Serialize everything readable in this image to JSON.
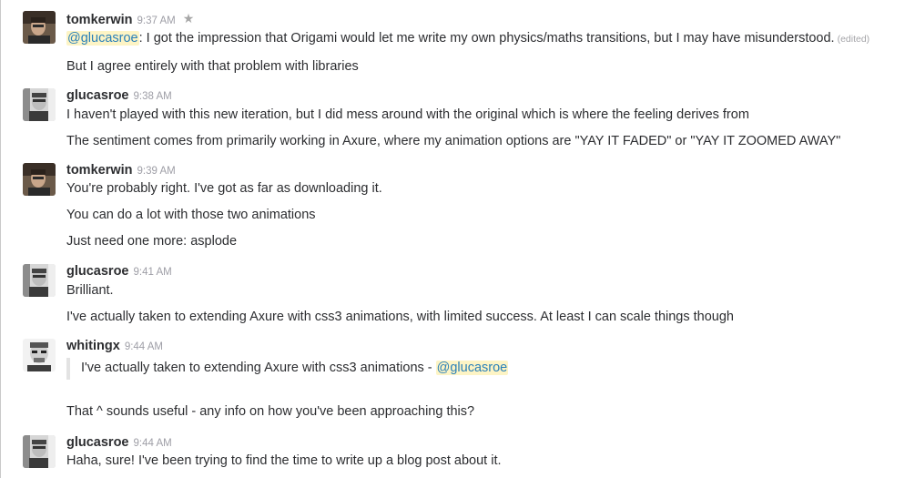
{
  "messages": [
    {
      "user": "tomkerwin",
      "time": "9:37 AM",
      "avatar": "avatar-tomkerwin",
      "starred": true,
      "lines": [
        {
          "mention": "@glucasroe",
          "text": ": I got the impression that Origami would let me write my own physics/maths transitions, but I may have misunderstood.",
          "edited": "(edited)"
        },
        {
          "text": "But I agree entirely with that problem with libraries"
        }
      ]
    },
    {
      "user": "glucasroe",
      "time": "9:38 AM",
      "avatar": "avatar-glucasroe",
      "lines": [
        {
          "text": "I haven't played with this new iteration, but I did mess around with the original which is where the feeling derives from"
        },
        {
          "text": "The sentiment comes from primarily working in Axure, where my animation options are \"YAY IT FADED\" or \"YAY IT ZOOMED AWAY\""
        }
      ]
    },
    {
      "user": "tomkerwin",
      "time": "9:39 AM",
      "avatar": "avatar-tomkerwin",
      "lines": [
        {
          "text": "You're probably right. I've got as far as downloading it."
        },
        {
          "text": "You can do a lot with those two animations"
        },
        {
          "text": "Just need one more: asplode"
        }
      ]
    },
    {
      "user": "glucasroe",
      "time": "9:41 AM",
      "avatar": "avatar-glucasroe",
      "lines": [
        {
          "text": "Brilliant."
        },
        {
          "text": "I've actually taken to extending Axure with css3 animations, with limited success. At least I can scale things though"
        }
      ]
    },
    {
      "user": "whitingx",
      "time": "9:44 AM",
      "avatar": "avatar-whitingx",
      "quote": {
        "text": "I've actually taken to extending Axure with css3 animations - ",
        "mention": "@glucasroe"
      },
      "lines": [
        {
          "text": "That ^ sounds useful - any info on how you've been approaching this?"
        }
      ]
    },
    {
      "user": "glucasroe",
      "time": "9:44 AM",
      "avatar": "avatar-glucasroe",
      "lines": [
        {
          "text": "Haha, sure! I've been trying to find the time to write up a blog post about it."
        }
      ]
    }
  ],
  "icons": {
    "star": "star-icon"
  },
  "colors": {
    "mention_bg": "#fdf4c5",
    "mention_text": "#2a80b9",
    "timestamp": "#9e9ea6"
  }
}
